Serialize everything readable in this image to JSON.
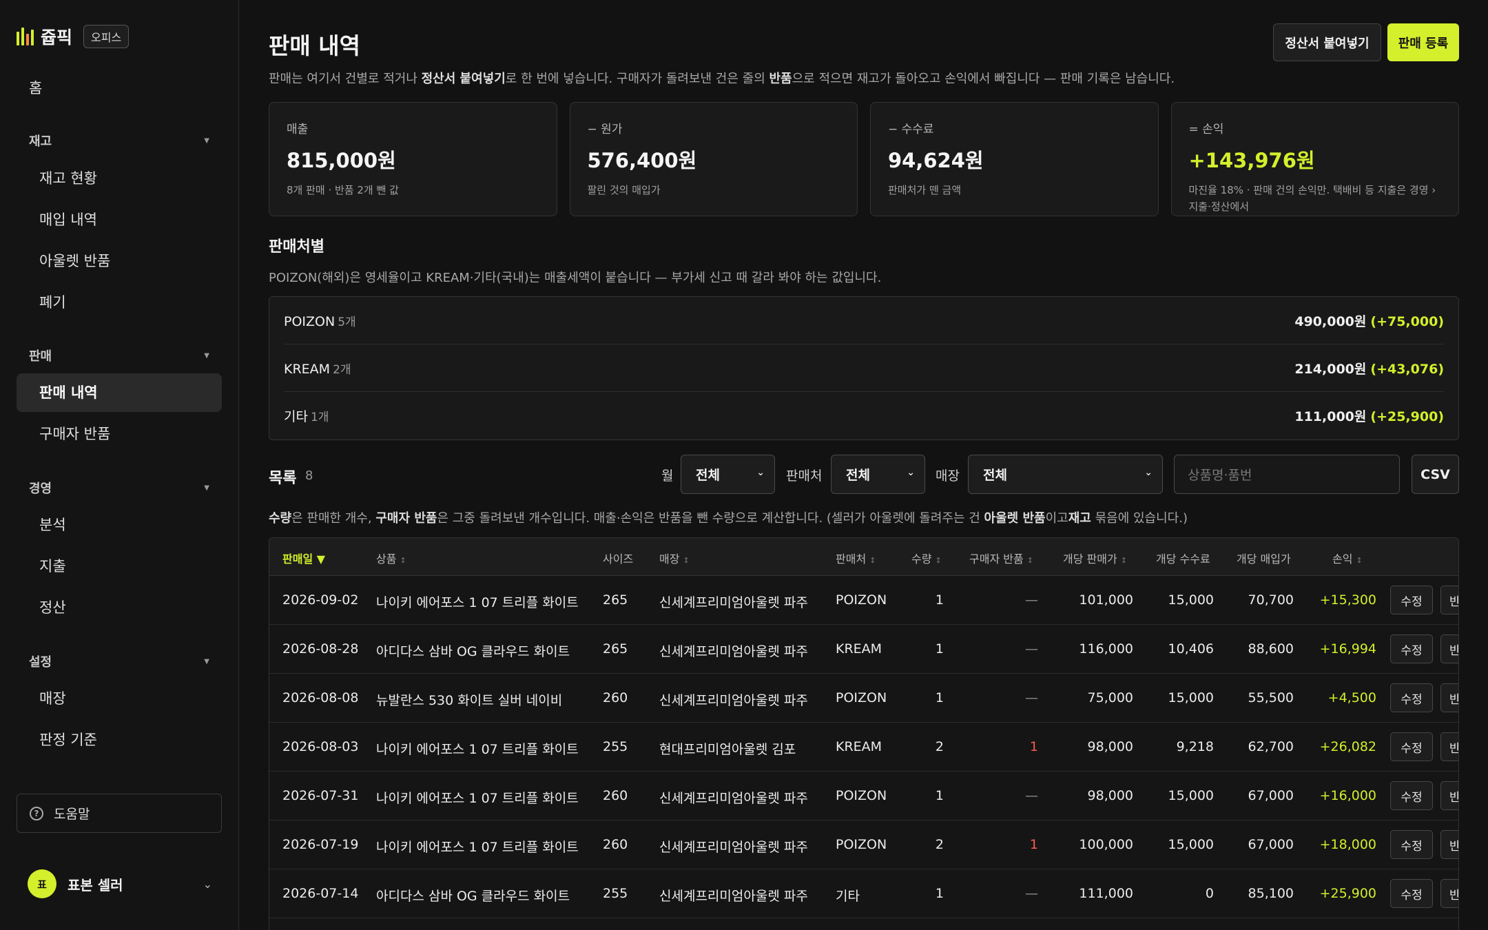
{
  "app": {
    "name": "쥽픽",
    "badge": "오피스"
  },
  "colors": {
    "accent": "#d4ef2c",
    "negative": "#ff5a4f",
    "background": "#121212"
  },
  "sidebar": {
    "home": "홈",
    "groups": [
      {
        "title": "재고",
        "items": [
          "재고 현황",
          "매입 내역",
          "아울렛 반품",
          "폐기"
        ]
      },
      {
        "title": "판매",
        "items": [
          "판매 내역",
          "구매자 반품"
        ]
      },
      {
        "title": "경영",
        "items": [
          "분석",
          "지출",
          "정산"
        ]
      },
      {
        "title": "설정",
        "items": [
          "매장",
          "판정 기준"
        ]
      }
    ],
    "active_item": "판매 내역",
    "help": "도움말",
    "user": {
      "initial": "표",
      "name": "표본 셀러"
    }
  },
  "header": {
    "title": "판매 내역",
    "paste_button": "정산서 붙여넣기",
    "register_button": "판매 등록",
    "desc_1": "판매는 여기서 건별로 적거나 ",
    "desc_b1": "정산서 붙여넣기",
    "desc_2": "로 한 번에 넣습니다. 구매자가 돌려보낸 건은 줄의 ",
    "desc_b2": "반품",
    "desc_3": "으로 적으면 재고가 돌아오고 손익에서 빠집니다 — 판매 기록은 남습니다."
  },
  "summary": [
    {
      "label": "매출",
      "value": "815,000원",
      "note": "8개 판매 · 반품 2개 뺀 값",
      "accent": false
    },
    {
      "label": "− 원가",
      "value": "576,400원",
      "note": "팔린 것의 매입가",
      "accent": false
    },
    {
      "label": "− 수수료",
      "value": "94,624원",
      "note": "판매처가 뗀 금액",
      "accent": false
    },
    {
      "label": "= 손익",
      "value": "+143,976원",
      "note": "마진율 18% · 판매 건의 손익만. 택배비 등 지출은 경영 › 지출·정산에서",
      "accent": true
    }
  ],
  "by_channel": {
    "title": "판매처별",
    "desc": "POIZON(해외)은 영세율이고 KREAM·기타(국내)는 매출세액이 붙습니다 — 부가세 신고 때 갈라 봐야 하는 값입니다.",
    "rows": [
      {
        "name": "POIZON",
        "count": "5개",
        "amount": "490,000원",
        "profit": "(+75,000)"
      },
      {
        "name": "KREAM",
        "count": "2개",
        "amount": "214,000원",
        "profit": "(+43,076)"
      },
      {
        "name": "기타",
        "count": "1개",
        "amount": "111,000원",
        "profit": "(+25,900)"
      }
    ]
  },
  "list": {
    "title": "목록",
    "count": "8",
    "filters": {
      "month_label": "월",
      "month_value": "전체",
      "channel_label": "판매처",
      "channel_value": "전체",
      "store_label": "매장",
      "store_value": "전체",
      "search_placeholder": "상품명·품번",
      "csv": "CSV"
    },
    "note_b1": "수량",
    "note_1": "은 판매한 개수, ",
    "note_b2": "구매자 반품",
    "note_2": "은 그중 돌려보낸 개수입니다. 매출·손익은 반품을 뺀 수량으로 계산합니다. (셀러가 아울렛에 돌려주는 건 ",
    "note_b3": "아울렛 반품",
    "note_3": "이고",
    "note_b4": "재고",
    "note_4": " 묶음에 있습니다.)",
    "columns": [
      "판매일 ▼",
      "상품",
      "사이즈",
      "매장",
      "판매처",
      "수량",
      "구매자 반품",
      "개당 판매가",
      "개당 수수료",
      "개당 매입가",
      "손익"
    ],
    "edit_label": "수정",
    "return_label": "반",
    "rows": [
      {
        "date": "2026-09-02",
        "product": "나이키 에어포스 1 07 트리플 화이트",
        "size": "265",
        "store": "신세계프리미엄아울렛 파주",
        "channel": "POIZON",
        "qty": "1",
        "returned": "—",
        "price": "101,000",
        "fee": "15,000",
        "cost": "70,700",
        "profit": "+15,300"
      },
      {
        "date": "2026-08-28",
        "product": "아디다스 삼바 OG 클라우드 화이트",
        "size": "265",
        "store": "신세계프리미엄아울렛 파주",
        "channel": "KREAM",
        "qty": "1",
        "returned": "—",
        "price": "116,000",
        "fee": "10,406",
        "cost": "88,600",
        "profit": "+16,994"
      },
      {
        "date": "2026-08-08",
        "product": "뉴발란스 530 화이트 실버 네이비",
        "size": "260",
        "store": "신세계프리미엄아울렛 파주",
        "channel": "POIZON",
        "qty": "1",
        "returned": "—",
        "price": "75,000",
        "fee": "15,000",
        "cost": "55,500",
        "profit": "+4,500"
      },
      {
        "date": "2026-08-03",
        "product": "나이키 에어포스 1 07 트리플 화이트",
        "size": "255",
        "store": "현대프리미엄아울렛 김포",
        "channel": "KREAM",
        "qty": "2",
        "returned": "1",
        "price": "98,000",
        "fee": "9,218",
        "cost": "62,700",
        "profit": "+26,082"
      },
      {
        "date": "2026-07-31",
        "product": "나이키 에어포스 1 07 트리플 화이트",
        "size": "260",
        "store": "신세계프리미엄아울렛 파주",
        "channel": "POIZON",
        "qty": "1",
        "returned": "—",
        "price": "98,000",
        "fee": "15,000",
        "cost": "67,000",
        "profit": "+16,000"
      },
      {
        "date": "2026-07-19",
        "product": "나이키 에어포스 1 07 트리플 화이트",
        "size": "260",
        "store": "신세계프리미엄아울렛 파주",
        "channel": "POIZON",
        "qty": "2",
        "returned": "1",
        "price": "100,000",
        "fee": "15,000",
        "cost": "67,000",
        "profit": "+18,000"
      },
      {
        "date": "2026-07-14",
        "product": "아디다스 삼바 OG 클라우드 화이트",
        "size": "255",
        "store": "신세계프리미엄아울렛 파주",
        "channel": "기타",
        "qty": "1",
        "returned": "—",
        "price": "111,000",
        "fee": "0",
        "cost": "85,100",
        "profit": "+25,900"
      }
    ]
  }
}
